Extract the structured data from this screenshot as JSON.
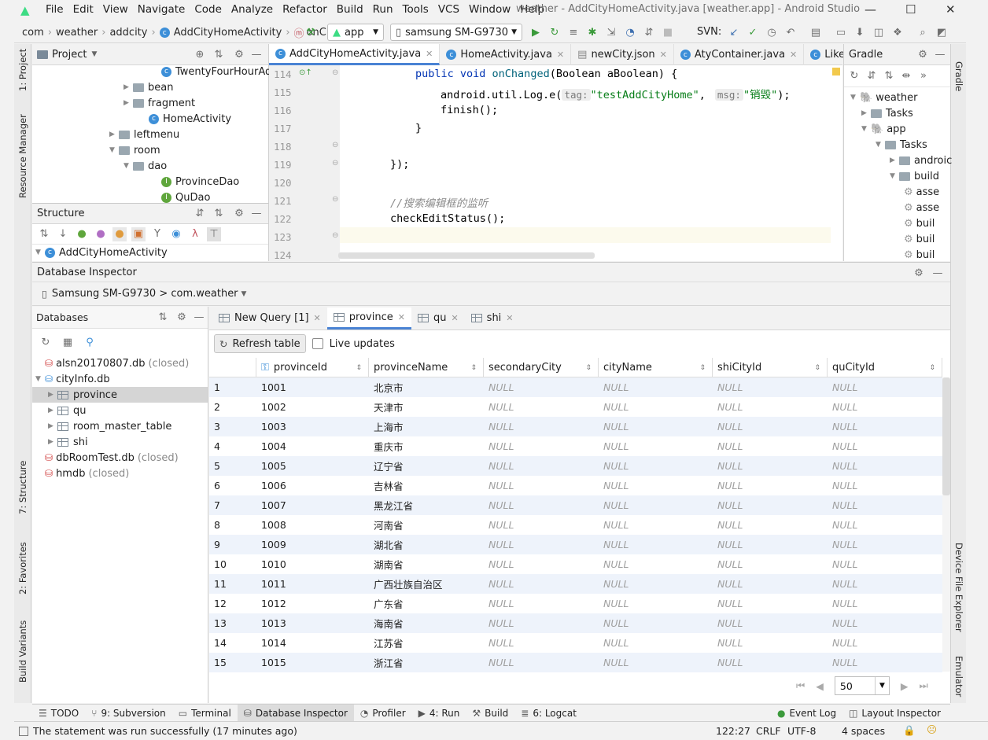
{
  "window": {
    "title": "weather - AddCityHomeActivity.java [weather.app] - Android Studio",
    "menu": [
      "File",
      "Edit",
      "View",
      "Navigate",
      "Code",
      "Analyze",
      "Refactor",
      "Build",
      "Run",
      "Tools",
      "VCS",
      "Window",
      "Help"
    ]
  },
  "navbar": {
    "breadcrumbs": [
      "com",
      "weather",
      "addcity",
      "AddCityHomeActivity",
      "onC"
    ],
    "run_config": "app",
    "device": "samsung SM-G9730",
    "svn_label": "SVN:"
  },
  "left_strip": {
    "project": "1: Project",
    "resource_manager": "Resource Manager",
    "structure": "7: Structure",
    "favorites": "2: Favorites",
    "build_variants": "Build Variants"
  },
  "right_strip": {
    "gradle": "Gradle",
    "device_file_explorer": "Device File Explorer",
    "emulator": "Emulator"
  },
  "project_panel": {
    "title": "Project",
    "items": [
      {
        "label": "TwentyFourHourAda",
        "kind": "class"
      },
      {
        "label": "bean",
        "kind": "folder"
      },
      {
        "label": "fragment",
        "kind": "folder"
      },
      {
        "label": "HomeActivity",
        "kind": "class"
      },
      {
        "label": "leftmenu",
        "kind": "folder"
      },
      {
        "label": "room",
        "kind": "folder"
      },
      {
        "label": "dao",
        "kind": "folder"
      },
      {
        "label": "ProvinceDao",
        "kind": "interface"
      },
      {
        "label": "QuDao",
        "kind": "interface"
      }
    ]
  },
  "structure_panel": {
    "title": "Structure",
    "root": "AddCityHomeActivity"
  },
  "editor": {
    "tabs": [
      "AddCityHomeActivity.java",
      "HomeActivity.java",
      "newCity.json",
      "AtyContainer.java",
      "LikeCityAc"
    ],
    "lines": [
      {
        "n": "114",
        "code_kw": "public void ",
        "code_mth": "onChanged",
        "code_rest": "(Boolean aBoolean) {"
      },
      {
        "n": "115",
        "pre": "android.util.Log.e(",
        "tag_hint": "tag:",
        "tag_str": "\"testAddCityHome\"",
        "mid": ",",
        "msg_hint": "msg:",
        "msg_str": "\"销毁\"",
        "post": ");"
      },
      {
        "n": "116",
        "text": "finish();"
      },
      {
        "n": "117",
        "text": "}"
      },
      {
        "n": "118",
        "text": ""
      },
      {
        "n": "119",
        "text": "});"
      },
      {
        "n": "120",
        "text": ""
      },
      {
        "n": "121",
        "comment": "//搜索编辑框的监听"
      },
      {
        "n": "122",
        "text": "checkEditStatus();"
      },
      {
        "n": "123",
        "text": "}"
      },
      {
        "n": "124",
        "text": ""
      }
    ]
  },
  "gradle_panel": {
    "title": "Gradle",
    "items": [
      "weather",
      "Tasks",
      "app",
      "Tasks",
      "androic",
      "build",
      "asse",
      "asse",
      "buil",
      "buil",
      "buil"
    ]
  },
  "db_inspector": {
    "title": "Database Inspector",
    "device": "Samsung SM-G9730 > com.weather",
    "databases_title": "Databases",
    "databases": [
      {
        "name": "alsn20170807.db",
        "status": "(closed)",
        "level": 0,
        "kind": "db-closed"
      },
      {
        "name": "cityInfo.db",
        "status": "",
        "level": 0,
        "kind": "db-open"
      },
      {
        "name": "province",
        "status": "",
        "level": 1,
        "kind": "table",
        "selected": true
      },
      {
        "name": "qu",
        "status": "",
        "level": 1,
        "kind": "table"
      },
      {
        "name": "room_master_table",
        "status": "",
        "level": 1,
        "kind": "table"
      },
      {
        "name": "shi",
        "status": "",
        "level": 1,
        "kind": "table"
      },
      {
        "name": "dbRoomTest.db",
        "status": "(closed)",
        "level": 0,
        "kind": "db-closed"
      },
      {
        "name": "hmdb",
        "status": "(closed)",
        "level": 0,
        "kind": "db-closed"
      }
    ],
    "tabs": [
      "New Query [1]",
      "province",
      "qu",
      "shi"
    ],
    "active_tab": "province",
    "refresh_label": "Refresh table",
    "live_updates_label": "Live updates",
    "columns": [
      "provinceId",
      "provinceName",
      "secondaryCity",
      "cityName",
      "shiCityId",
      "quCityId"
    ],
    "null_text": "NULL",
    "rows": [
      [
        "1",
        "1001",
        "北京市"
      ],
      [
        "2",
        "1002",
        "天津市"
      ],
      [
        "3",
        "1003",
        "上海市"
      ],
      [
        "4",
        "1004",
        "重庆市"
      ],
      [
        "5",
        "1005",
        "辽宁省"
      ],
      [
        "6",
        "1006",
        "吉林省"
      ],
      [
        "7",
        "1007",
        "黑龙江省"
      ],
      [
        "8",
        "1008",
        "河南省"
      ],
      [
        "9",
        "1009",
        "湖北省"
      ],
      [
        "10",
        "1010",
        "湖南省"
      ],
      [
        "11",
        "1011",
        "广西壮族自治区"
      ],
      [
        "12",
        "1012",
        "广东省"
      ],
      [
        "13",
        "1013",
        "海南省"
      ],
      [
        "14",
        "1014",
        "江苏省"
      ],
      [
        "15",
        "1015",
        "浙江省"
      ]
    ],
    "page_size": "50"
  },
  "tool_tabs": {
    "left": [
      "TODO",
      "9: Subversion",
      "Terminal",
      "Database Inspector",
      "Profiler",
      "4: Run",
      "Build",
      "6: Logcat"
    ],
    "active": "Database Inspector",
    "right": [
      "Event Log",
      "Layout Inspector"
    ]
  },
  "status_bar": {
    "message": "The statement was run successfully (17 minutes ago)",
    "position": "122:27",
    "line_sep": "CRLF",
    "encoding": "UTF-8",
    "indent": "4 spaces"
  }
}
